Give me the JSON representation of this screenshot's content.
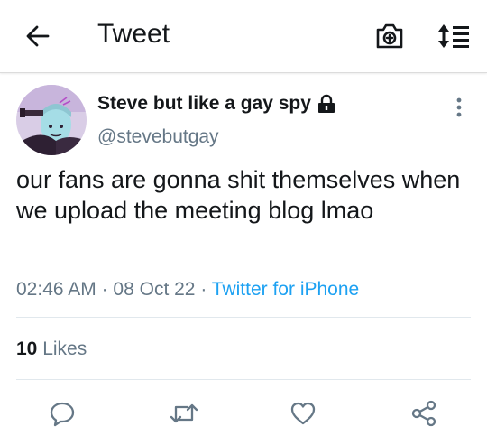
{
  "header": {
    "title": "Tweet",
    "back_icon": "arrow-left-icon",
    "camera_icon": "camera-plus-icon",
    "sort_icon": "sort-list-icon"
  },
  "tweet": {
    "display_name": "Steve but like a gay spy",
    "protected_icon": "lock-icon",
    "handle": "@stevebutgay",
    "text": "our fans are gonna shit themselves when we upload the meeting blog lmao",
    "time": "02:46 AM",
    "date": "08 Oct 22",
    "separator": "·",
    "source": "Twitter for iPhone"
  },
  "stats": {
    "likes_count": "10",
    "likes_label": "Likes"
  },
  "actions": {
    "reply_icon": "reply-icon",
    "retweet_icon": "retweet-icon",
    "like_icon": "heart-icon",
    "share_icon": "share-icon"
  },
  "colors": {
    "link": "#1da1f2",
    "secondary_text": "#657786",
    "primary_text": "#14171a",
    "divider": "#e1e8ed"
  }
}
